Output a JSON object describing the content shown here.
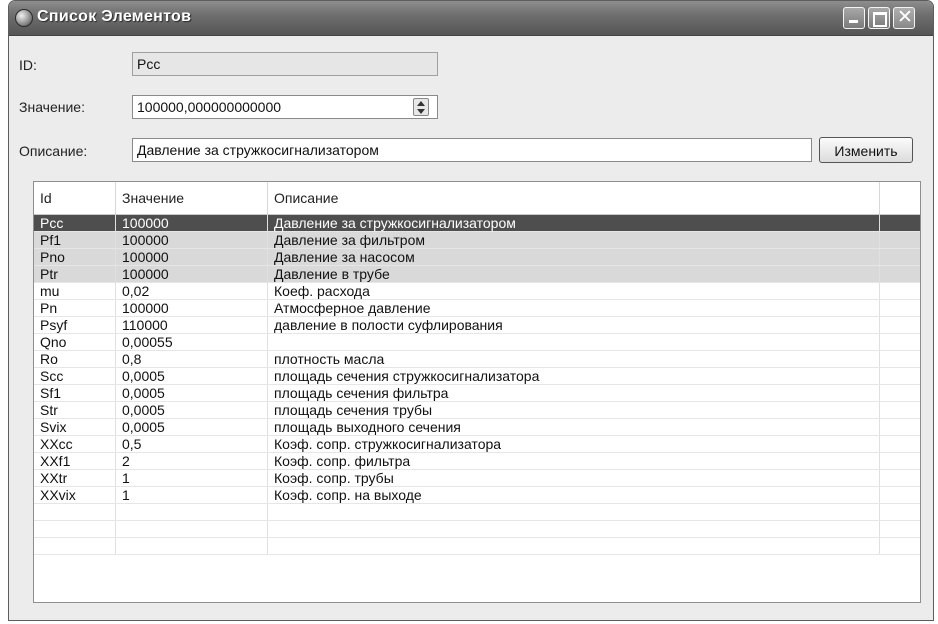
{
  "window": {
    "title": "Список Элементов",
    "icon": "app-icon"
  },
  "form": {
    "id_label": "ID:",
    "id_value": "Pcc",
    "value_label": "Значение:",
    "value_value": "100000,000000000000",
    "desc_label": "Описание:",
    "desc_value": "Давление за стружкосигнализатором",
    "change_button": "Изменить"
  },
  "table": {
    "columns": [
      "Id",
      "Значение",
      "Описание"
    ],
    "selected_index": 0,
    "highlighted_indices": [
      1,
      2,
      3
    ],
    "rows": [
      {
        "id": "Pcc",
        "value": "100000",
        "desc": "Давление за стружкосигнализатором"
      },
      {
        "id": "Pf1",
        "value": "100000",
        "desc": "Давление за фильтром"
      },
      {
        "id": "Pno",
        "value": "100000",
        "desc": "Давление за насосом"
      },
      {
        "id": "Ptr",
        "value": "100000",
        "desc": "Давление в трубе"
      },
      {
        "id": "mu",
        "value": "0,02",
        "desc": "Коеф. расхода"
      },
      {
        "id": "Pn",
        "value": "100000",
        "desc": "Атмосферное давление"
      },
      {
        "id": "Psyf",
        "value": "110000",
        "desc": "давление в полости суфлирования"
      },
      {
        "id": "Qno",
        "value": "0,00055",
        "desc": ""
      },
      {
        "id": "Ro",
        "value": "0,8",
        "desc": "плотность масла"
      },
      {
        "id": "Scc",
        "value": "0,0005",
        "desc": "площадь сечения стружкосигнализатора"
      },
      {
        "id": "Sf1",
        "value": "0,0005",
        "desc": "площадь сечения фильтра"
      },
      {
        "id": "Str",
        "value": "0,0005",
        "desc": "площадь сечения трубы"
      },
      {
        "id": "Svix",
        "value": "0,0005",
        "desc": "площадь выходного сечения"
      },
      {
        "id": "XXcc",
        "value": "0,5",
        "desc": "Коэф. сопр. стружкосигнализатора"
      },
      {
        "id": "XXf1",
        "value": "2",
        "desc": "Коэф. сопр. фильтра"
      },
      {
        "id": "XXtr",
        "value": "1",
        "desc": "Коэф. сопр. трубы"
      },
      {
        "id": "XXvix",
        "value": "1",
        "desc": "Коэф. сопр. на выходе"
      }
    ]
  },
  "colors": {
    "selected_row": "#4e4e4e",
    "highlighted_row": "#d9d9d9",
    "titlebar": "#6f6f6f"
  }
}
